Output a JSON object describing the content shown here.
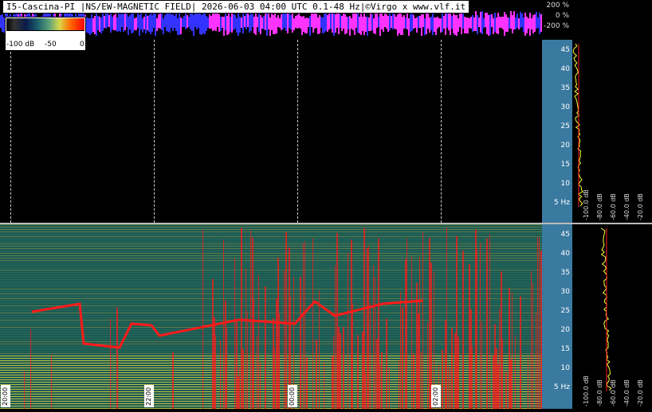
{
  "title": "I5-Cascina-PI |NS/EW-MAGNETIC FIELD| 2026-06-03 04:00 UTC 0.1-48 Hz|©Virgo x www.vlf.it",
  "polarization_scale": [
    "200 %",
    "0 %",
    "-200 %"
  ],
  "colorbar": {
    "ticks": [
      "-100 dB",
      "-50",
      "0"
    ]
  },
  "freq_labels_upper": [
    "45",
    "40",
    "35",
    "30",
    "25",
    "20",
    "15",
    "10",
    "5 Hz"
  ],
  "freq_labels_lower": [
    "45",
    "40",
    "35",
    "30",
    "25",
    "20",
    "15",
    "10",
    "5 Hz"
  ],
  "db_labels": [
    "-100.0 dB",
    "-80.0 dB",
    "-60.0 dB",
    "-40.0 dB",
    "-20.0 dB"
  ],
  "db_labels_lower": [
    "-100.0 dB",
    "-80.0 dB",
    "-60.0 dB",
    "-40.0 dB",
    "-20.0 dB"
  ],
  "time_labels": [
    "20:00",
    "22:00",
    "00:00",
    "02:00"
  ],
  "colors": {
    "band_magenta": "#ff33ff",
    "band_blue": "#3333ff",
    "scale_bg": "#3b7aa0",
    "trace_red": "#ff1a1a",
    "trace_yellow": "#ffff33"
  }
}
